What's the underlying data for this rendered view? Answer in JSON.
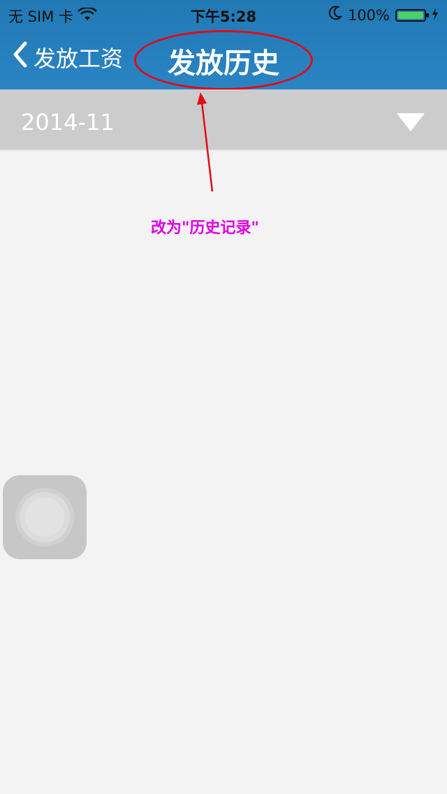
{
  "status_bar": {
    "carrier": "无 SIM 卡",
    "time": "下午5:28",
    "battery": "100%",
    "battery_level": 1.0,
    "battery_color": "#4ad263"
  },
  "nav": {
    "back_label": "发放工资",
    "title": "发放历史"
  },
  "filter": {
    "period": "2014-11"
  },
  "annotation": {
    "text": "改为\"历史记录\"",
    "color": "#e000e8",
    "ellipse_color": "#e10b16"
  },
  "icons": {
    "back": "chevron-left-icon",
    "dropdown": "triangle-down-icon",
    "wifi": "wifi-icon",
    "moon": "moon-icon",
    "charging": "bolt-icon",
    "assistive": "assistive-touch-icon"
  }
}
